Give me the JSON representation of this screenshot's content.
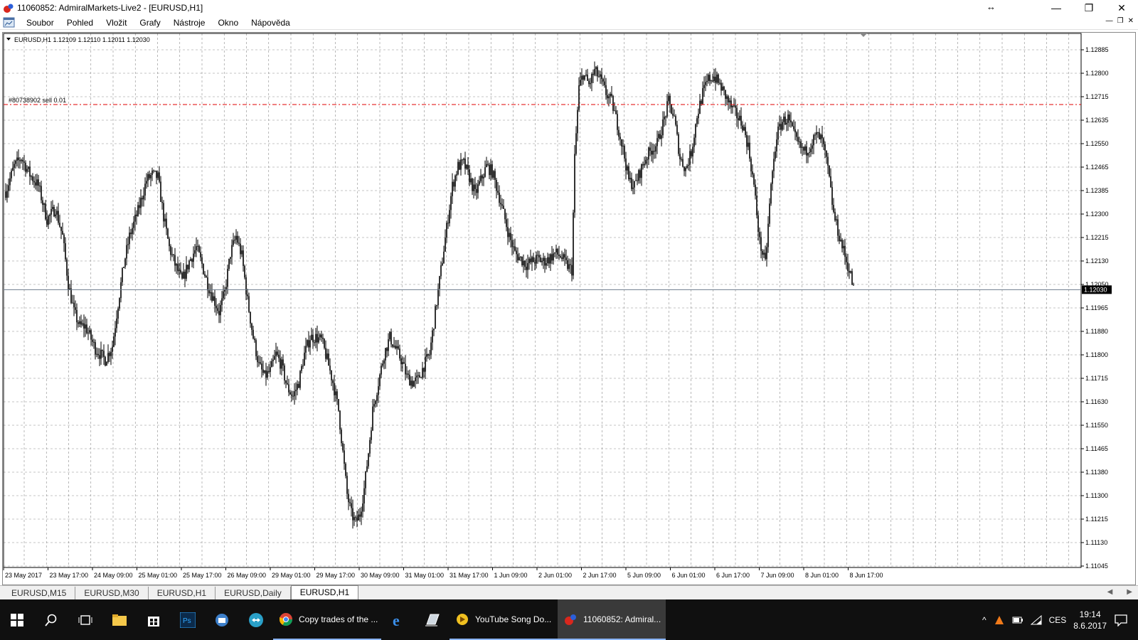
{
  "window": {
    "title": "11060852: AdmiralMarkets-Live2 - [EURUSD,H1]",
    "controls": {
      "minimize": "—",
      "restore": "❐",
      "close": "✕"
    }
  },
  "menu": [
    "Soubor",
    "Pohled",
    "Vložit",
    "Grafy",
    "Nástroje",
    "Okno",
    "Nápověda"
  ],
  "chart": {
    "header": "EURUSD,H1  1.12109 1.12110 1.12011 1.12030",
    "order_label": "#80738902 sell 0.01",
    "current_price_label": "1.12030",
    "colors": {
      "grid": "#8a8a8a",
      "candle": "#000000",
      "order_line": "#e00000",
      "bid_line": "#6e7b8b",
      "price_tag_bg": "#000000"
    }
  },
  "chart_data": {
    "type": "candlestick",
    "symbol": "EURUSD",
    "timeframe": "H1",
    "ohlc_last": {
      "open": 1.12109,
      "high": 1.1211,
      "low": 1.12011,
      "close": 1.1203
    },
    "y_ticks": [
      "1.12885",
      "1.12800",
      "1.12715",
      "1.12635",
      "1.12550",
      "1.12465",
      "1.12385",
      "1.12300",
      "1.12215",
      "1.12130",
      "1.12050",
      "1.11965",
      "1.11880",
      "1.11800",
      "1.11715",
      "1.11630",
      "1.11550",
      "1.11465",
      "1.11380",
      "1.11300",
      "1.11215",
      "1.11130",
      "1.11045"
    ],
    "ylim": [
      1.11045,
      1.12935
    ],
    "x_ticks": [
      "23 May 2017",
      "23 May 17:00",
      "24 May 09:00",
      "25 May 01:00",
      "25 May 17:00",
      "26 May 09:00",
      "29 May 01:00",
      "29 May 17:00",
      "30 May 09:00",
      "31 May 01:00",
      "31 May 17:00",
      "1 Jun 09:00",
      "2 Jun 01:00",
      "2 Jun 17:00",
      "5 Jun 09:00",
      "6 Jun 01:00",
      "6 Jun 17:00",
      "7 Jun 09:00",
      "8 Jun 01:00",
      "8 Jun 17:00"
    ],
    "order_level": 1.1269,
    "current_price": 1.1203,
    "path_points": [
      [
        0,
        1.1238
      ],
      [
        6,
        1.1247
      ],
      [
        11,
        1.125
      ],
      [
        17,
        1.1244
      ],
      [
        23,
        1.124
      ],
      [
        29,
        1.1228
      ],
      [
        35,
        1.1232
      ],
      [
        40,
        1.1222
      ],
      [
        44,
        1.1205
      ],
      [
        48,
        1.1195
      ],
      [
        52,
        1.119
      ],
      [
        56,
        1.119
      ],
      [
        63,
        1.1182
      ],
      [
        70,
        1.1178
      ],
      [
        75,
        1.1183
      ],
      [
        79,
        1.1198
      ],
      [
        83,
        1.1212
      ],
      [
        87,
        1.1222
      ],
      [
        93,
        1.1231
      ],
      [
        99,
        1.1242
      ],
      [
        103,
        1.1244
      ],
      [
        107,
        1.1243
      ],
      [
        111,
        1.1229
      ],
      [
        115,
        1.1218
      ],
      [
        119,
        1.1212
      ],
      [
        124,
        1.1206
      ],
      [
        129,
        1.1213
      ],
      [
        134,
        1.1218
      ],
      [
        138,
        1.1212
      ],
      [
        142,
        1.1205
      ],
      [
        146,
        1.12
      ],
      [
        150,
        1.1195
      ],
      [
        154,
        1.1202
      ],
      [
        158,
        1.1216
      ],
      [
        162,
        1.1222
      ],
      [
        166,
        1.1215
      ],
      [
        170,
        1.1199
      ],
      [
        174,
        1.1186
      ],
      [
        178,
        1.1176
      ],
      [
        182,
        1.1172
      ],
      [
        186,
        1.1174
      ],
      [
        190,
        1.118
      ],
      [
        194,
        1.1176
      ],
      [
        198,
        1.1168
      ],
      [
        202,
        1.1165
      ],
      [
        206,
        1.117
      ],
      [
        210,
        1.118
      ],
      [
        214,
        1.1186
      ],
      [
        218,
        1.1186
      ],
      [
        222,
        1.1185
      ],
      [
        226,
        1.1178
      ],
      [
        230,
        1.117
      ],
      [
        234,
        1.116
      ],
      [
        237,
        1.1145
      ],
      [
        240,
        1.113
      ],
      [
        243,
        1.1123
      ],
      [
        246,
        1.112
      ],
      [
        249,
        1.1123
      ],
      [
        252,
        1.1132
      ],
      [
        255,
        1.1145
      ],
      [
        258,
        1.116
      ],
      [
        262,
        1.117
      ],
      [
        266,
        1.118
      ],
      [
        270,
        1.1186
      ],
      [
        274,
        1.1182
      ],
      [
        278,
        1.1178
      ],
      [
        282,
        1.1172
      ],
      [
        286,
        1.117
      ],
      [
        290,
        1.1171
      ],
      [
        294,
        1.1176
      ],
      [
        298,
        1.118
      ],
      [
        302,
        1.1195
      ],
      [
        306,
        1.121
      ],
      [
        310,
        1.1225
      ],
      [
        314,
        1.124
      ],
      [
        318,
        1.1247
      ],
      [
        322,
        1.1248
      ],
      [
        326,
        1.1243
      ],
      [
        330,
        1.1237
      ],
      [
        334,
        1.1242
      ],
      [
        338,
        1.1247
      ],
      [
        342,
        1.1245
      ],
      [
        346,
        1.1238
      ],
      [
        350,
        1.123
      ],
      [
        354,
        1.1222
      ],
      [
        358,
        1.1216
      ],
      [
        362,
        1.1214
      ],
      [
        366,
        1.1212
      ],
      [
        370,
        1.1213
      ],
      [
        374,
        1.1214
      ],
      [
        378,
        1.1213
      ],
      [
        382,
        1.1214
      ],
      [
        386,
        1.1216
      ],
      [
        390,
        1.1215
      ],
      [
        394,
        1.1212
      ],
      [
        398,
        1.121
      ],
      [
        400,
        1.125
      ],
      [
        403,
        1.1275
      ],
      [
        406,
        1.128
      ],
      [
        410,
        1.1276
      ],
      [
        414,
        1.1281
      ],
      [
        418,
        1.1278
      ],
      [
        422,
        1.1273
      ],
      [
        426,
        1.127
      ],
      [
        430,
        1.1262
      ],
      [
        434,
        1.1253
      ],
      [
        438,
        1.1242
      ],
      [
        442,
        1.124
      ],
      [
        446,
        1.1245
      ],
      [
        450,
        1.125
      ],
      [
        454,
        1.1253
      ],
      [
        458,
        1.1255
      ],
      [
        462,
        1.1262
      ],
      [
        466,
        1.127
      ],
      [
        470,
        1.1264
      ],
      [
        474,
        1.125
      ],
      [
        478,
        1.1246
      ],
      [
        482,
        1.1252
      ],
      [
        486,
        1.1265
      ],
      [
        490,
        1.1273
      ],
      [
        494,
        1.1278
      ],
      [
        498,
        1.1279
      ],
      [
        502,
        1.1276
      ],
      [
        506,
        1.1272
      ],
      [
        510,
        1.1268
      ],
      [
        514,
        1.1265
      ],
      [
        518,
        1.1262
      ],
      [
        522,
        1.1254
      ],
      [
        526,
        1.124
      ],
      [
        530,
        1.122
      ],
      [
        534,
        1.1212
      ],
      [
        538,
        1.124
      ],
      [
        542,
        1.1258
      ],
      [
        546,
        1.1263
      ],
      [
        550,
        1.1264
      ],
      [
        554,
        1.1258
      ],
      [
        558,
        1.1254
      ],
      [
        562,
        1.1252
      ],
      [
        566,
        1.1255
      ],
      [
        570,
        1.1258
      ],
      [
        574,
        1.1256
      ],
      [
        578,
        1.1246
      ],
      [
        582,
        1.123
      ],
      [
        586,
        1.1222
      ],
      [
        590,
        1.1215
      ],
      [
        594,
        1.1208
      ],
      [
        596,
        1.1203
      ]
    ]
  },
  "tabs": [
    "EURUSD,M15",
    "EURUSD,M30",
    "EURUSD,H1",
    "EURUSD,Daily",
    "EURUSD,H1"
  ],
  "taskbar": {
    "apps": [
      {
        "label": "Copy trades of the ..."
      },
      {
        "label": "YouTube Song Do..."
      },
      {
        "label": "11060852: Admiral..."
      }
    ],
    "tray": {
      "lang": "CES",
      "time": "19:14",
      "date": "8.6.2017"
    }
  }
}
